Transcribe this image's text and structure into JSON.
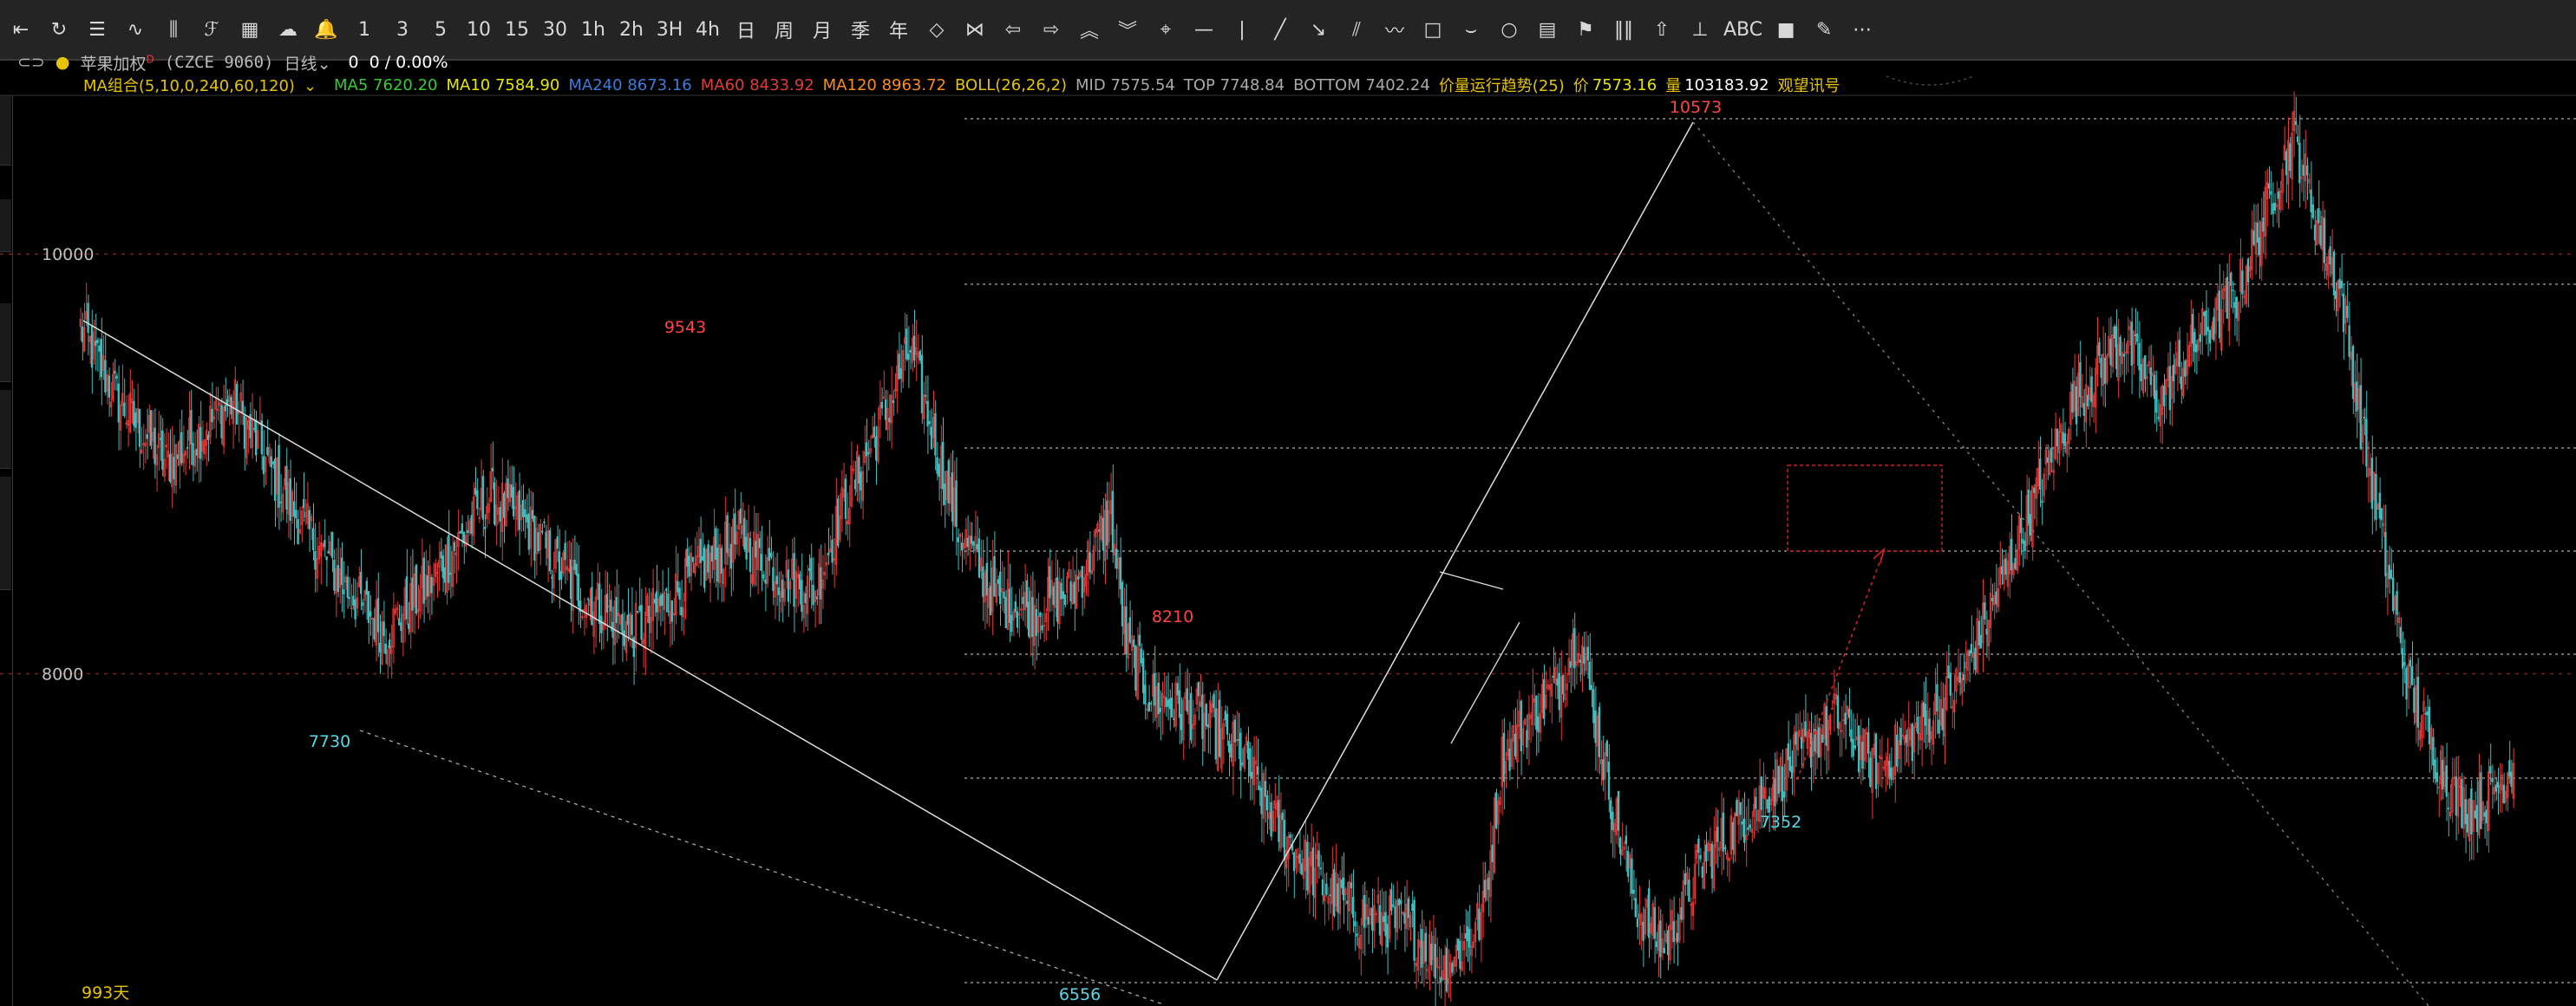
{
  "toolbar": {
    "items": [
      {
        "name": "back-icon",
        "glyph": "⇤"
      },
      {
        "name": "refresh-icon",
        "glyph": "↻"
      },
      {
        "name": "list-icon",
        "glyph": "☰"
      },
      {
        "name": "line-chart-icon",
        "glyph": "∿"
      },
      {
        "name": "candlestick-icon",
        "glyph": "⫼"
      },
      {
        "name": "indicator-icon",
        "glyph": "ℱ"
      },
      {
        "name": "calculator-icon",
        "glyph": "▦"
      },
      {
        "name": "cloud-icon",
        "glyph": "☁"
      },
      {
        "name": "bell-icon",
        "glyph": "🔔"
      },
      {
        "name": "period-1",
        "label": "1"
      },
      {
        "name": "period-3",
        "label": "3"
      },
      {
        "name": "period-5",
        "label": "5"
      },
      {
        "name": "period-10",
        "label": "10"
      },
      {
        "name": "period-15",
        "label": "15"
      },
      {
        "name": "period-30",
        "label": "30"
      },
      {
        "name": "period-1h",
        "label": "1h"
      },
      {
        "name": "period-2h",
        "label": "2h"
      },
      {
        "name": "period-3h",
        "label": "3H"
      },
      {
        "name": "period-4h",
        "label": "4h"
      },
      {
        "name": "period-day",
        "label": "日"
      },
      {
        "name": "period-week",
        "label": "周"
      },
      {
        "name": "period-month",
        "label": "月"
      },
      {
        "name": "period-quarter",
        "label": "季"
      },
      {
        "name": "period-year",
        "label": "年"
      },
      {
        "name": "zoom-in-icon",
        "glyph": "◇"
      },
      {
        "name": "zoom-out-icon",
        "glyph": "⋈"
      },
      {
        "name": "arrow-left-icon",
        "glyph": "⇦"
      },
      {
        "name": "arrow-right-icon",
        "glyph": "⇨"
      },
      {
        "name": "chevron-up-icon",
        "glyph": "︽"
      },
      {
        "name": "chevron-down-icon",
        "glyph": "︾"
      },
      {
        "name": "crosshair-icon",
        "glyph": "⌖"
      },
      {
        "name": "horizontal-line-icon",
        "glyph": "—"
      },
      {
        "name": "vertical-line-icon",
        "glyph": "|"
      },
      {
        "name": "trend-line-icon",
        "glyph": "╱"
      },
      {
        "name": "ray-line-icon",
        "glyph": "↘"
      },
      {
        "name": "parallel-line-icon",
        "glyph": "⫽"
      },
      {
        "name": "wave-icon",
        "glyph": "〰"
      },
      {
        "name": "rectangle-icon",
        "glyph": "□"
      },
      {
        "name": "arc-icon",
        "glyph": "⌣"
      },
      {
        "name": "circle-icon",
        "glyph": "○"
      },
      {
        "name": "fibonacci-icon",
        "glyph": "▤"
      },
      {
        "name": "gann-icon",
        "glyph": "⚑"
      },
      {
        "name": "cycle-lines-icon",
        "glyph": "‖‖"
      },
      {
        "name": "arrow-up-icon",
        "glyph": "⇧"
      },
      {
        "name": "ruler-icon",
        "glyph": "⊥"
      },
      {
        "name": "text-tool",
        "label": "ABC"
      },
      {
        "name": "fill-icon",
        "glyph": "■"
      },
      {
        "name": "eraser-icon",
        "glyph": "✎"
      },
      {
        "name": "more-icon",
        "glyph": "⋯"
      }
    ]
  },
  "info": {
    "link_icon": "link-icon",
    "dot_icon": "dot-icon",
    "contract": "苹果加权",
    "superscript": "D",
    "code": "(CZCE 9060)",
    "period": "日线",
    "value": "0",
    "change": "0 / 0.00%"
  },
  "legend": {
    "ma_group": "MA组合(5,10,0,240,60,120)",
    "ma5": "MA5 7620.20",
    "ma10": "MA10 7584.90",
    "ma240": "MA240 8673.16",
    "ma60": "MA60 8433.92",
    "ma120": "MA120 8963.72",
    "boll": "BOLL(26,26,2)",
    "mid": "MID 7575.54",
    "top": "TOP 7748.84",
    "bottom": "BOTTOM 7402.24",
    "trend_label": "价量运行趋势(25)",
    "price_label": "价",
    "price_value": "7573.16",
    "volume_label": "量",
    "volume_value": "103183.92",
    "signal": "观望讯号"
  },
  "colors": {
    "ma5": "#33cc33",
    "ma10": "#e6e600",
    "ma240": "#3d7bd9",
    "ma60": "#e03b3b",
    "ma120": "#ff8c1a",
    "boll": "#e6c300",
    "up": "#e83a3a",
    "down": "#3fbfbf",
    "peak_red": "#ff4444",
    "low_cyan": "#55d8e8"
  },
  "chart_data": {
    "type": "candlestick",
    "ylim": [
      6470,
      10860
    ],
    "yticks": [
      8000,
      10000
    ],
    "ytick_labels": [
      "8000",
      "10000"
    ],
    "bar_count_label": "993天",
    "annotations": [
      {
        "label": "9543",
        "value": 9543,
        "kind": "high"
      },
      {
        "label": "8210",
        "value": 8210,
        "kind": "high"
      },
      {
        "label": "10573",
        "value": 10573,
        "kind": "high"
      },
      {
        "label": "7730",
        "value": 7730,
        "kind": "low"
      },
      {
        "label": "6556",
        "value": 6556,
        "kind": "low"
      },
      {
        "label": "7352",
        "value": 7352,
        "kind": "low"
      }
    ],
    "anchors": [
      [
        0,
        9650
      ],
      [
        20,
        9300
      ],
      [
        45,
        9000
      ],
      [
        80,
        9300
      ],
      [
        110,
        8800
      ],
      [
        140,
        8400
      ],
      [
        160,
        8200
      ],
      [
        185,
        8450
      ],
      [
        215,
        8850
      ],
      [
        235,
        8700
      ],
      [
        260,
        8400
      ],
      [
        290,
        8200
      ],
      [
        320,
        8450
      ],
      [
        345,
        8650
      ],
      [
        370,
        8450
      ],
      [
        385,
        8400
      ],
      [
        400,
        8800
      ],
      [
        420,
        9200
      ],
      [
        435,
        9550
      ],
      [
        445,
        9200
      ],
      [
        460,
        8700
      ],
      [
        480,
        8350
      ],
      [
        500,
        8300
      ],
      [
        520,
        8400
      ],
      [
        540,
        8750
      ],
      [
        548,
        8150
      ],
      [
        560,
        7900
      ],
      [
        585,
        7800
      ],
      [
        610,
        7600
      ],
      [
        625,
        7300
      ],
      [
        650,
        7000
      ],
      [
        670,
        6850
      ],
      [
        695,
        6800
      ],
      [
        715,
        6600
      ],
      [
        725,
        6700
      ],
      [
        735,
        6850
      ],
      [
        745,
        7600
      ],
      [
        760,
        7800
      ],
      [
        775,
        7950
      ],
      [
        785,
        8210
      ],
      [
        800,
        7500
      ],
      [
        815,
        6900
      ],
      [
        830,
        6700
      ],
      [
        850,
        7100
      ],
      [
        875,
        7350
      ],
      [
        900,
        7600
      ],
      [
        920,
        7800
      ],
      [
        940,
        7550
      ],
      [
        960,
        7700
      ],
      [
        985,
        7950
      ],
      [
        1005,
        8400
      ],
      [
        1025,
        8850
      ],
      [
        1045,
        9300
      ],
      [
        1070,
        9600
      ],
      [
        1090,
        9300
      ],
      [
        1110,
        9600
      ],
      [
        1130,
        9800
      ],
      [
        1145,
        10200
      ],
      [
        1160,
        10573
      ],
      [
        1172,
        10150
      ],
      [
        1185,
        9800
      ],
      [
        1195,
        9200
      ],
      [
        1207,
        8600
      ],
      [
        1220,
        7950
      ],
      [
        1235,
        7600
      ],
      [
        1245,
        7400
      ],
      [
        1255,
        7352
      ],
      [
        1265,
        7450
      ],
      [
        1275,
        7573
      ]
    ]
  }
}
